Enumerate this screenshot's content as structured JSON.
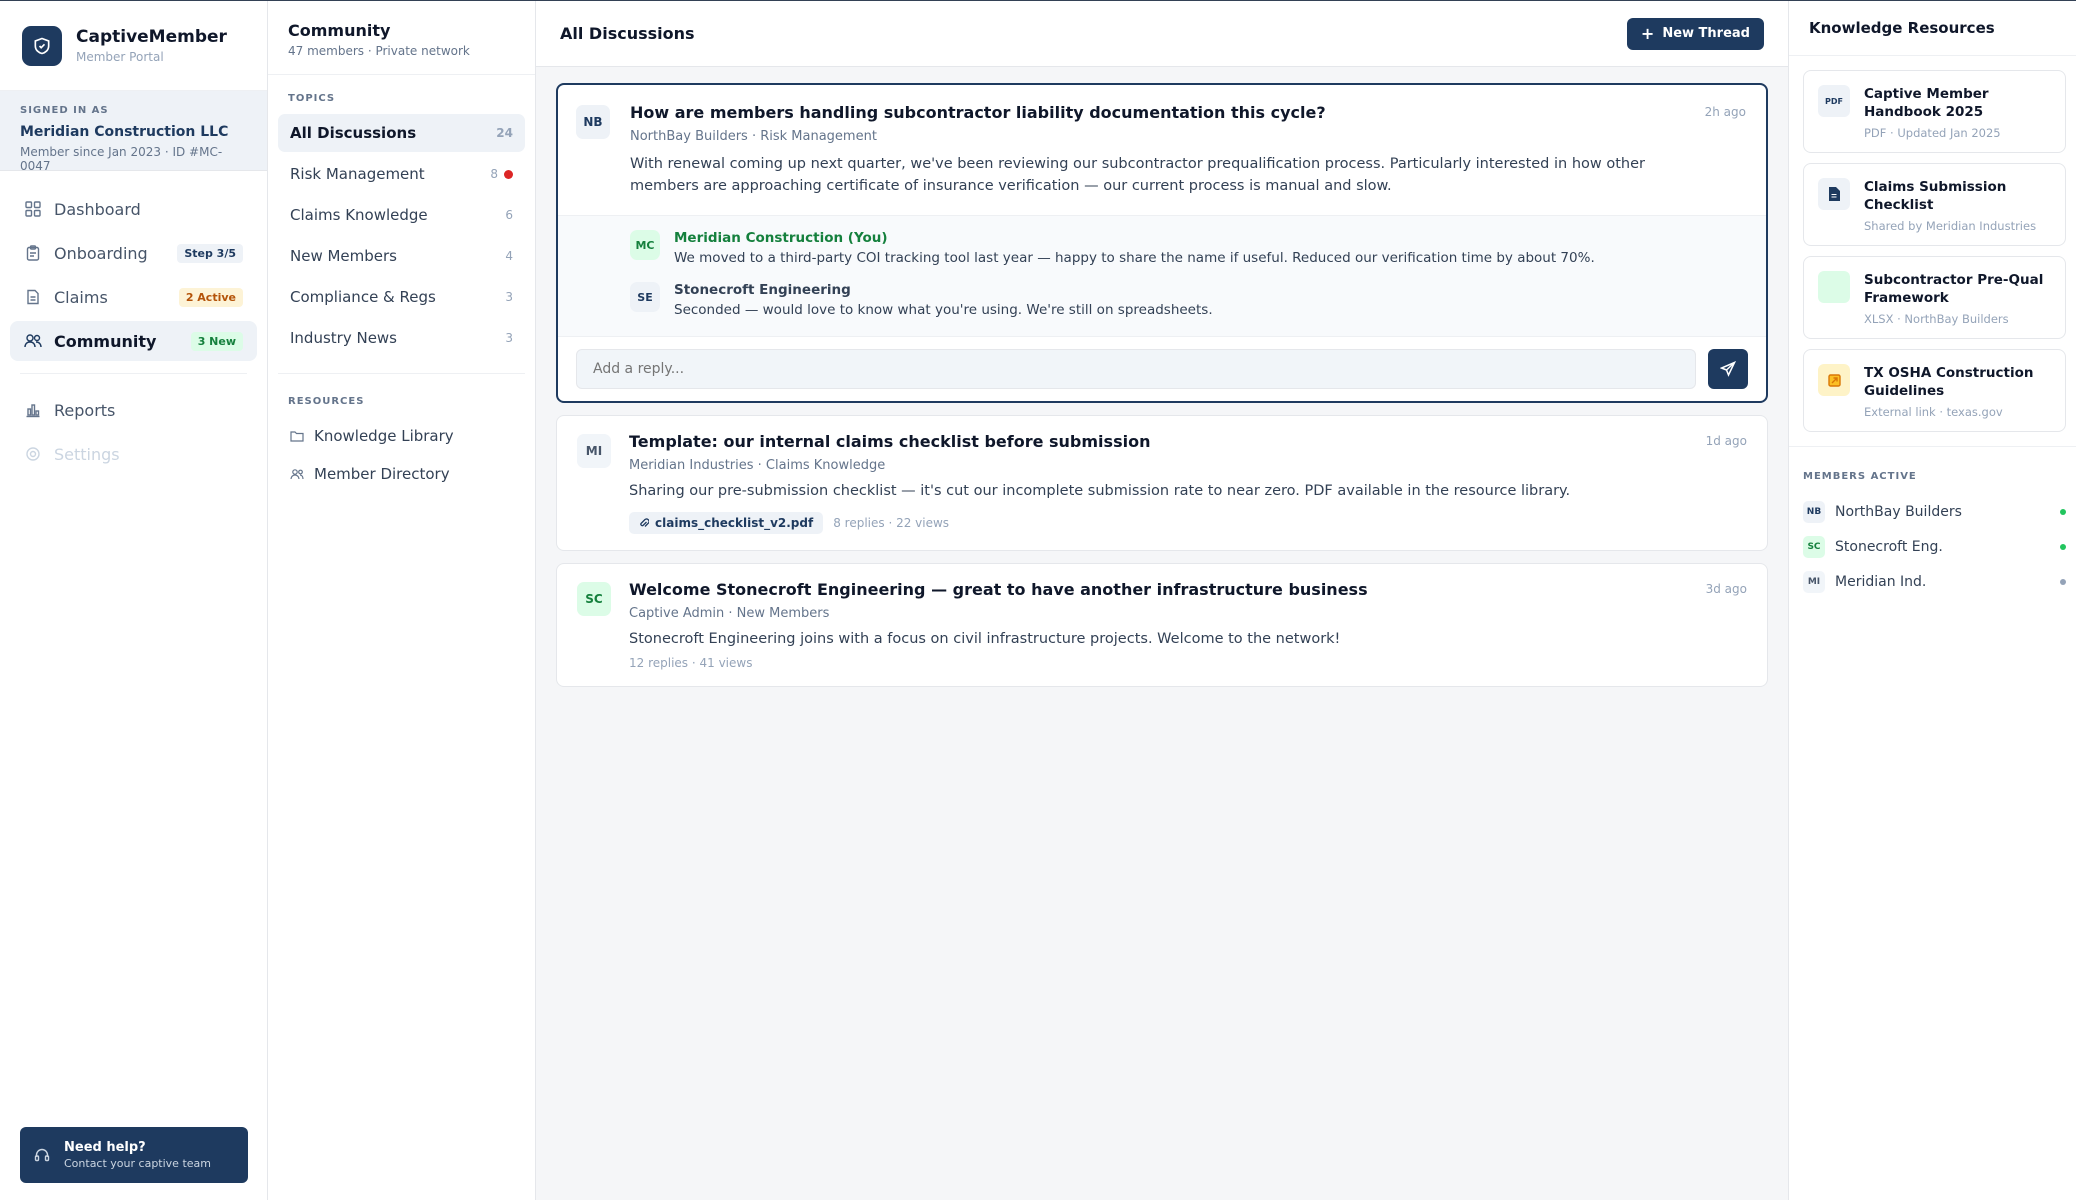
{
  "brand": {
    "name": "CaptiveMember",
    "sub": "Member Portal"
  },
  "signed_in": {
    "label": "SIGNED IN AS",
    "org": "Meridian Construction LLC",
    "meta": "Member since Jan 2023 · ID #MC-0047"
  },
  "nav": [
    {
      "label": "Dashboard",
      "icon": "grid-icon"
    },
    {
      "label": "Onboarding",
      "icon": "clipboard-icon",
      "badge": "Step 3/5"
    },
    {
      "label": "Claims",
      "icon": "document-icon",
      "badge": "2 Active"
    },
    {
      "label": "Community",
      "icon": "users-icon",
      "badge": "3 New"
    },
    {
      "label": "Reports",
      "icon": "bar-chart-icon"
    },
    {
      "label": "Settings",
      "icon": "gear-icon"
    }
  ],
  "help": {
    "title": "Need help?",
    "sub": "Contact your captive team"
  },
  "community": {
    "title": "Community",
    "sub": "47 members · Private network"
  },
  "topics_label": "TOPICS",
  "topics": [
    {
      "label": "All Discussions",
      "count": "24"
    },
    {
      "label": "Risk Management",
      "count": "8"
    },
    {
      "label": "Claims Knowledge",
      "count": "6"
    },
    {
      "label": "New Members",
      "count": "4"
    },
    {
      "label": "Compliance & Regs",
      "count": "3"
    },
    {
      "label": "Industry News",
      "count": "3"
    }
  ],
  "resources_label": "RESOURCES",
  "resources": [
    {
      "label": "Knowledge Library"
    },
    {
      "label": "Member Directory"
    }
  ],
  "main": {
    "title": "All Discussions",
    "new_thread": "New Thread"
  },
  "threads": [
    {
      "initials": "NB",
      "title": "How are members handling subcontractor liability documentation this cycle?",
      "meta": "NorthBay Builders · Risk Management",
      "time": "2h ago",
      "body": "With renewal coming up next quarter, we've been reviewing our subcontractor prequalification process. Particularly interested in how other members are approaching certificate of insurance verification — our current process is manual and slow.",
      "replies": [
        {
          "initials": "MC",
          "name": "Meridian Construction (You)",
          "text": "We moved to a third-party COI tracking tool last year — happy to share the name if useful. Reduced our verification time by about 70%."
        },
        {
          "initials": "SE",
          "name": "Stonecroft Engineering",
          "text": "Seconded — would love to know what you're using. We're still on spreadsheets."
        }
      ],
      "reply_placeholder": "Add a reply..."
    },
    {
      "initials": "MI",
      "title": "Template: our internal claims checklist before submission",
      "meta": "Meridian Industries · Claims Knowledge",
      "time": "1d ago",
      "body": "Sharing our pre-submission checklist — it's cut our incomplete submission rate to near zero. PDF available in the resource library.",
      "attachment": "claims_checklist_v2.pdf",
      "stats": "8 replies · 22 views"
    },
    {
      "initials": "SC",
      "title": "Welcome Stonecroft Engineering — great to have another infrastructure business",
      "meta": "Captive Admin · New Members",
      "time": "3d ago",
      "body": "Stonecroft Engineering joins with a focus on civil infrastructure projects. Welcome to the network!",
      "stats": "12 replies · 41 views"
    }
  ],
  "knowledge": {
    "title": "Knowledge Resources",
    "items": [
      {
        "name": "Captive Member Handbook 2025",
        "sub": "PDF · Updated Jan 2025",
        "icon": "pdf-icon",
        "icon_text": "PDF"
      },
      {
        "name": "Claims Submission Checklist",
        "sub": "Shared by Meridian Industries",
        "icon": "file-icon"
      },
      {
        "name": "Subcontractor Pre-Qual Framework",
        "sub": "XLSX · NorthBay Builders",
        "icon": "spreadsheet-icon"
      },
      {
        "name": "TX OSHA Construction Guidelines",
        "sub": "External link · texas.gov",
        "icon": "external-link-icon"
      }
    ]
  },
  "members_active": {
    "label": "MEMBERS ACTIVE",
    "items": [
      {
        "initials": "NB",
        "name": "NorthBay Builders",
        "online": true
      },
      {
        "initials": "SC",
        "name": "Stonecroft Eng.",
        "online": true
      },
      {
        "initials": "MI",
        "name": "Meridian Ind.",
        "online": false
      }
    ]
  },
  "colors": {
    "brand": "#1e3a5f",
    "online": "#22c55e",
    "alert": "#dc2626",
    "success": "#15803d"
  }
}
